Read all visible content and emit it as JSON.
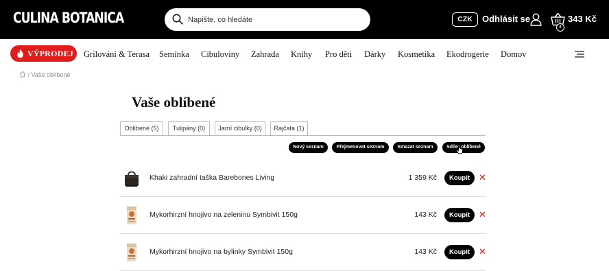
{
  "header": {
    "logo_text": "CULINA BOTANICA",
    "search_placeholder": "Napište, co hledáte",
    "currency": "CZK",
    "logout_label": "Odhlásit se",
    "cart_count": "4",
    "cart_total": "343 Kč"
  },
  "nav": {
    "sale_label": "VÝPRODEJ",
    "items": [
      "Grilování & Terasa",
      "Semínka",
      "Cibuloviny",
      "Zahrada",
      "Knihy",
      "Pro děti",
      "Dárky",
      "Kosmetika",
      "Ekodrogerie",
      "Domov"
    ]
  },
  "breadcrumb": {
    "current": "Vaše oblíbené"
  },
  "page": {
    "title": "Vaše oblíbené"
  },
  "tabs": [
    "Oblíbené (5)",
    "Tulipány (0)",
    "Jarní cibulky (0)",
    "Rajčata (1)"
  ],
  "actions": [
    "Nový seznam",
    "Přejmenovat seznam",
    "Smazat seznam",
    "Sdílet oblíbené"
  ],
  "products": [
    {
      "name": "Khaki zahradní taška Barebones Living",
      "price": "1 359 Kč",
      "buy_label": "Koupit",
      "remove": "✕"
    },
    {
      "name": "Mykorhirzní hnojivo na zeleninu Symbivit 150g",
      "price": "143 Kč",
      "buy_label": "Koupit",
      "remove": "✕"
    },
    {
      "name": "Mykorhirzní hnojivo na bylinky Symbivit 150g",
      "price": "143 Kč",
      "buy_label": "Koupit",
      "remove": "✕"
    }
  ],
  "colors": {
    "sale": "#e21b1b",
    "remove": "#dd1111",
    "topbar": "#000000"
  }
}
